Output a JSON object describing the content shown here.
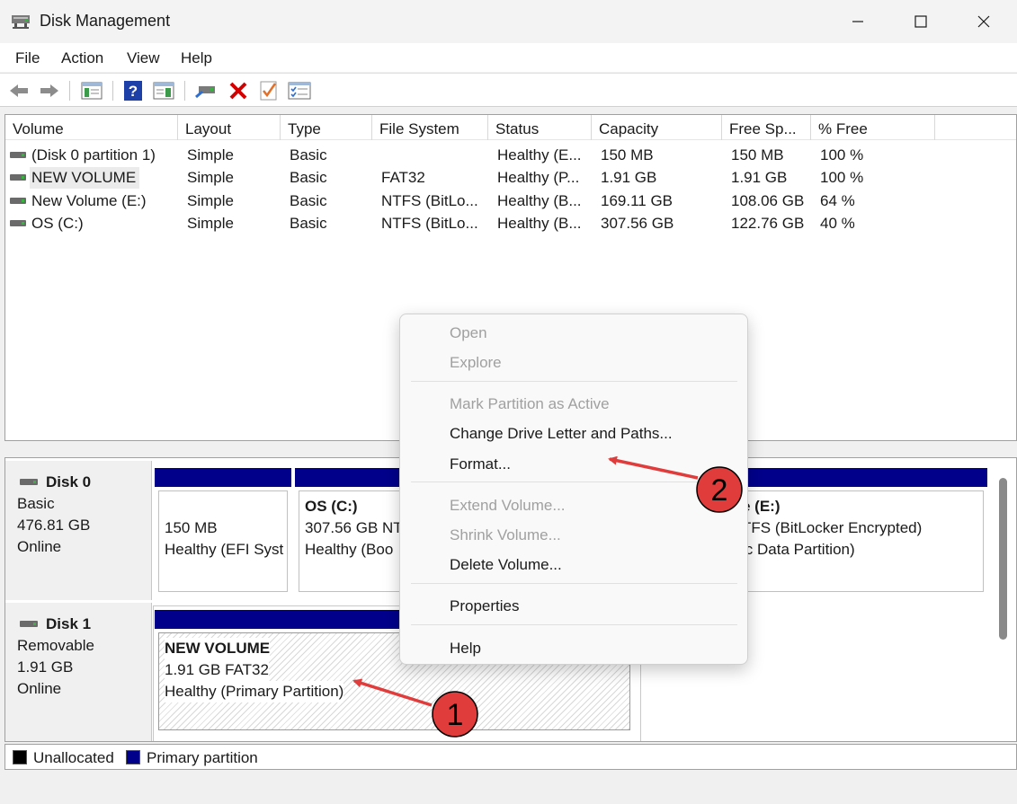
{
  "window": {
    "title": "Disk Management"
  },
  "menu": [
    "File",
    "Action",
    "View",
    "Help"
  ],
  "toolbar": {
    "icons": [
      "back-arrow-icon",
      "forward-arrow-icon",
      "console-tree-icon",
      "help-icon",
      "show-pane-icon",
      "connect-icon",
      "delete-icon",
      "check-icon",
      "properties-icon"
    ],
    "delete_color": "#d40000"
  },
  "volume_list": {
    "columns": [
      "Volume",
      "Layout",
      "Type",
      "File System",
      "Status",
      "Capacity",
      "Free Sp...",
      "% Free"
    ],
    "rows": [
      [
        "(Disk 0 partition 1)",
        "Simple",
        "Basic",
        "",
        "Healthy (E...",
        "150 MB",
        "150 MB",
        "100 %"
      ],
      [
        "NEW VOLUME",
        "Simple",
        "Basic",
        "FAT32",
        "Healthy (P...",
        "1.91 GB",
        "1.91 GB",
        "100 %"
      ],
      [
        "New Volume (E:)",
        "Simple",
        "Basic",
        "NTFS (BitLo...",
        "Healthy (B...",
        "169.11 GB",
        "108.06 GB",
        "64 %"
      ],
      [
        "OS (C:)",
        "Simple",
        "Basic",
        "NTFS (BitLo...",
        "Healthy (B...",
        "307.56 GB",
        "122.76 GB",
        "40 %"
      ]
    ]
  },
  "disks": [
    {
      "name": "Disk 0",
      "type": "Basic",
      "size": "476.81 GB",
      "state": "Online",
      "partitions": [
        {
          "size": "150 MB",
          "status": "Healthy (EFI Syst"
        },
        {
          "name": "OS  (C:)",
          "size": "307.56 GB NT",
          "status": "Healthy (Boo"
        },
        {
          "name": "e  (E:)",
          "size": "TFS (BitLocker Encrypted)",
          "status": "ic Data Partition)"
        }
      ]
    },
    {
      "name": "Disk 1",
      "type": "Removable",
      "size": "1.91 GB",
      "state": "Online",
      "partitions": [
        {
          "name": "NEW VOLUME",
          "size": "1.91 GB FAT32",
          "status": "Healthy (Primary Partition)"
        }
      ]
    }
  ],
  "legend": [
    {
      "label": "Unallocated",
      "color": "#000000"
    },
    {
      "label": "Primary partition",
      "color": "#00008b"
    }
  ],
  "context_menu": {
    "groups": [
      [
        {
          "label": "Open",
          "enabled": false
        },
        {
          "label": "Explore",
          "enabled": false
        }
      ],
      [
        {
          "label": "Mark Partition as Active",
          "enabled": false
        },
        {
          "label": "Change Drive Letter and Paths...",
          "enabled": true
        },
        {
          "label": "Format...",
          "enabled": true
        }
      ],
      [
        {
          "label": "Extend Volume...",
          "enabled": false
        },
        {
          "label": "Shrink Volume...",
          "enabled": false
        },
        {
          "label": "Delete Volume...",
          "enabled": true
        }
      ],
      [
        {
          "label": "Properties",
          "enabled": true
        }
      ],
      [
        {
          "label": "Help",
          "enabled": true
        }
      ]
    ]
  },
  "annotations": {
    "color": "#e03c3c",
    "badges": [
      "1",
      "2"
    ]
  }
}
